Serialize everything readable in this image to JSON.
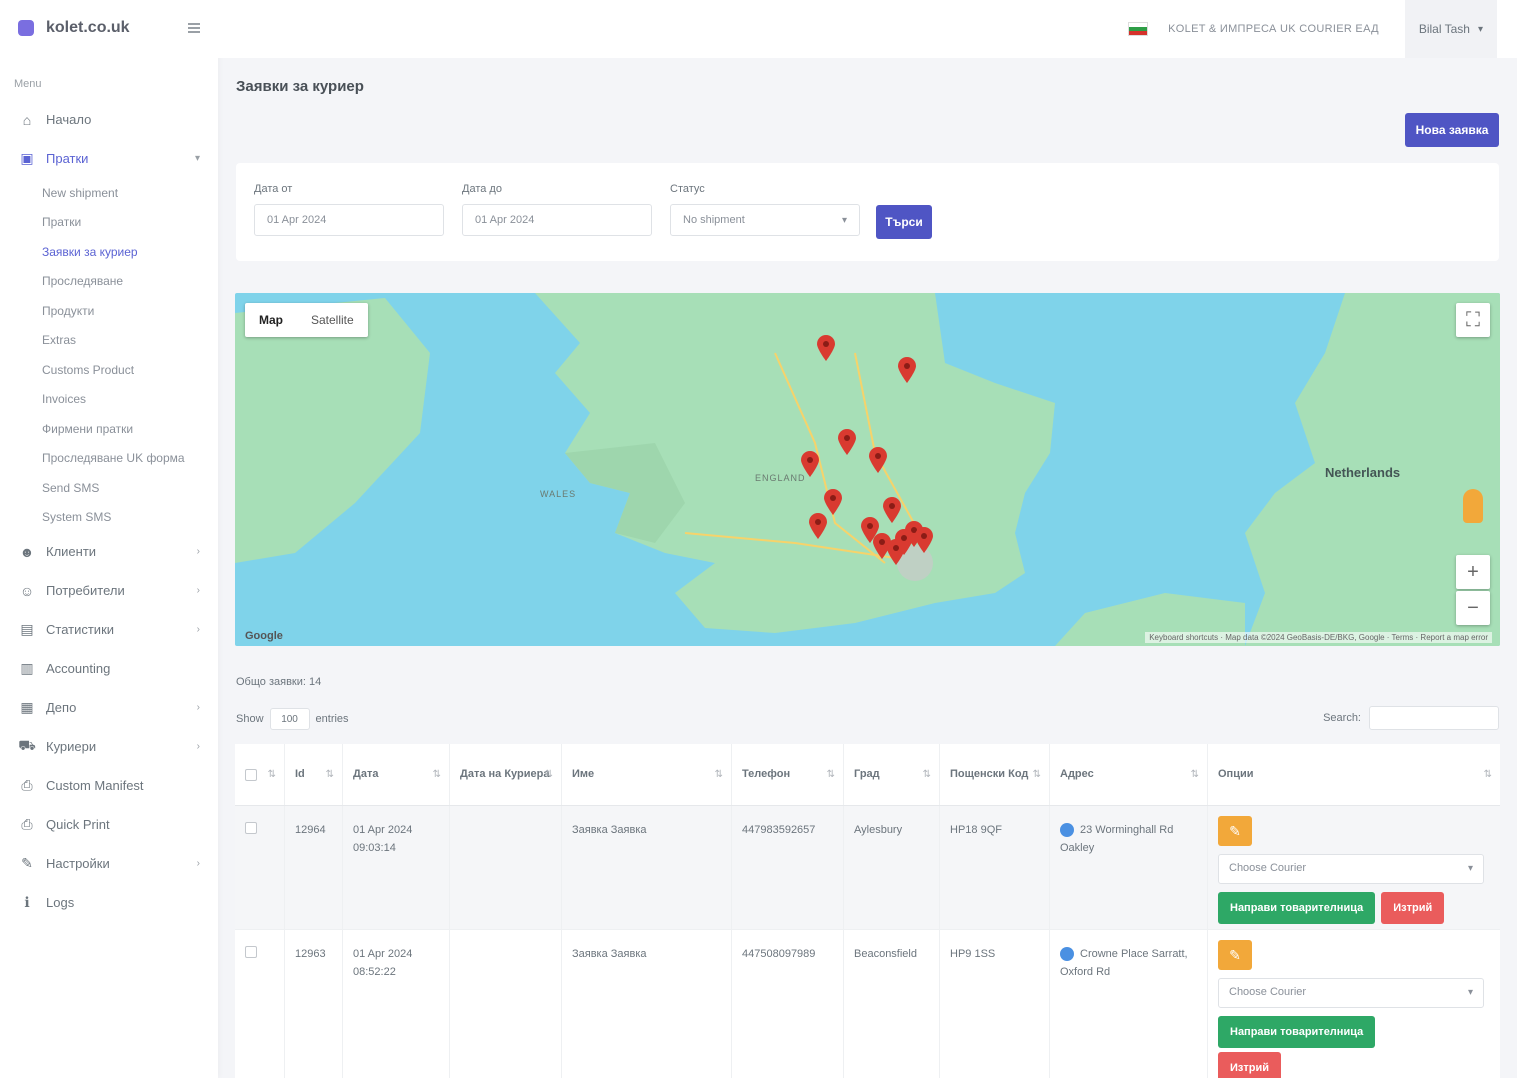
{
  "brand": {
    "name": "kolet.co.uk"
  },
  "sidebar": {
    "menu_title": "Menu",
    "items": [
      {
        "label": "Начало",
        "icon": "home-icon"
      },
      {
        "label": "Пратки",
        "icon": "parcel-icon"
      },
      {
        "label": "Клиенти",
        "icon": "clients-icon"
      },
      {
        "label": "Потребители",
        "icon": "users-icon"
      },
      {
        "label": "Статистики",
        "icon": "stats-icon"
      },
      {
        "label": "Accounting",
        "icon": "accounting-icon"
      },
      {
        "label": "Депо",
        "icon": "depot-icon"
      },
      {
        "label": "Куриери",
        "icon": "courier-icon"
      },
      {
        "label": "Custom Manifest",
        "icon": "print-icon"
      },
      {
        "label": "Quick Print",
        "icon": "print-icon"
      },
      {
        "label": "Настройки",
        "icon": "wrench-icon"
      },
      {
        "label": "Logs",
        "icon": "info-icon"
      }
    ],
    "sub_items": [
      "New shipment",
      "Пратки",
      "Заявки за куриер",
      "Проследяване",
      "Продукти",
      "Extras",
      "Customs Product",
      "Invoices",
      "Фирмени пратки",
      "Проследяване UK форма",
      "Send SMS",
      "System SMS"
    ]
  },
  "topbar": {
    "link": "KOLET & ИМПРЕСА UK COURIER ЕАД",
    "user": "Bilal Tash"
  },
  "page": {
    "title": "Заявки за куриер",
    "add_button": "Нова заявка"
  },
  "filters": {
    "date_from_label": "Дата от",
    "date_from_value": "01 Apr 2024",
    "date_to_label": "Дата до",
    "date_to_value": "01 Apr 2024",
    "status_label": "Статус",
    "status_value": "No shipment",
    "search_button": "Търси"
  },
  "map": {
    "toggle_map": "Map",
    "toggle_satellite": "Satellite",
    "country_netherlands": "Netherlands",
    "region_wales": "WALES",
    "region_england": "ENGLAND",
    "attribution": "Keyboard shortcuts · Map data ©2024 GeoBasis-DE/BKG, Google · Terms · Report a map error",
    "google": "Google"
  },
  "table": {
    "info": "Общо заявки: 14",
    "show_label": "Show",
    "show_value": "100",
    "entries_label": "entries",
    "search_label": "Search:",
    "headers": [
      "",
      "Id",
      "Дата",
      "Дата на Куриера",
      "Име",
      "Телефон",
      "Град",
      "Пощенски Код",
      "Адрес",
      "Опции"
    ],
    "rows": [
      {
        "id": "12964",
        "date": "01 Apr 2024 09:03:14",
        "courier_date": "",
        "name": "Заявка Заявка",
        "phone": "447983592657",
        "city": "Aylesbury",
        "postcode": "HP18 9QF",
        "address": "23 Worminghall Rd Oakley",
        "courier_placeholder": "Choose Courier",
        "green_btn": "Направи товарителница",
        "red_btn": "Изтрий"
      },
      {
        "id": "12963",
        "date": "01 Apr 2024 08:52:22",
        "courier_date": "",
        "name": "Заявка Заявка",
        "phone": "447508097989",
        "city": "Beaconsfield",
        "postcode": "HP9 1SS",
        "address": "Crowne Place Sarratt, Oxford Rd",
        "courier_placeholder": "Choose Courier",
        "green_btn": "Направи товарителница",
        "red_btn": "Изтрий"
      }
    ]
  },
  "colors": {
    "primary": "#4f55c4",
    "success": "#2ea866",
    "danger": "#ea5c5c",
    "warning": "#f2a83a",
    "water": "#7fd3ea",
    "land": "#a7dfb7"
  }
}
